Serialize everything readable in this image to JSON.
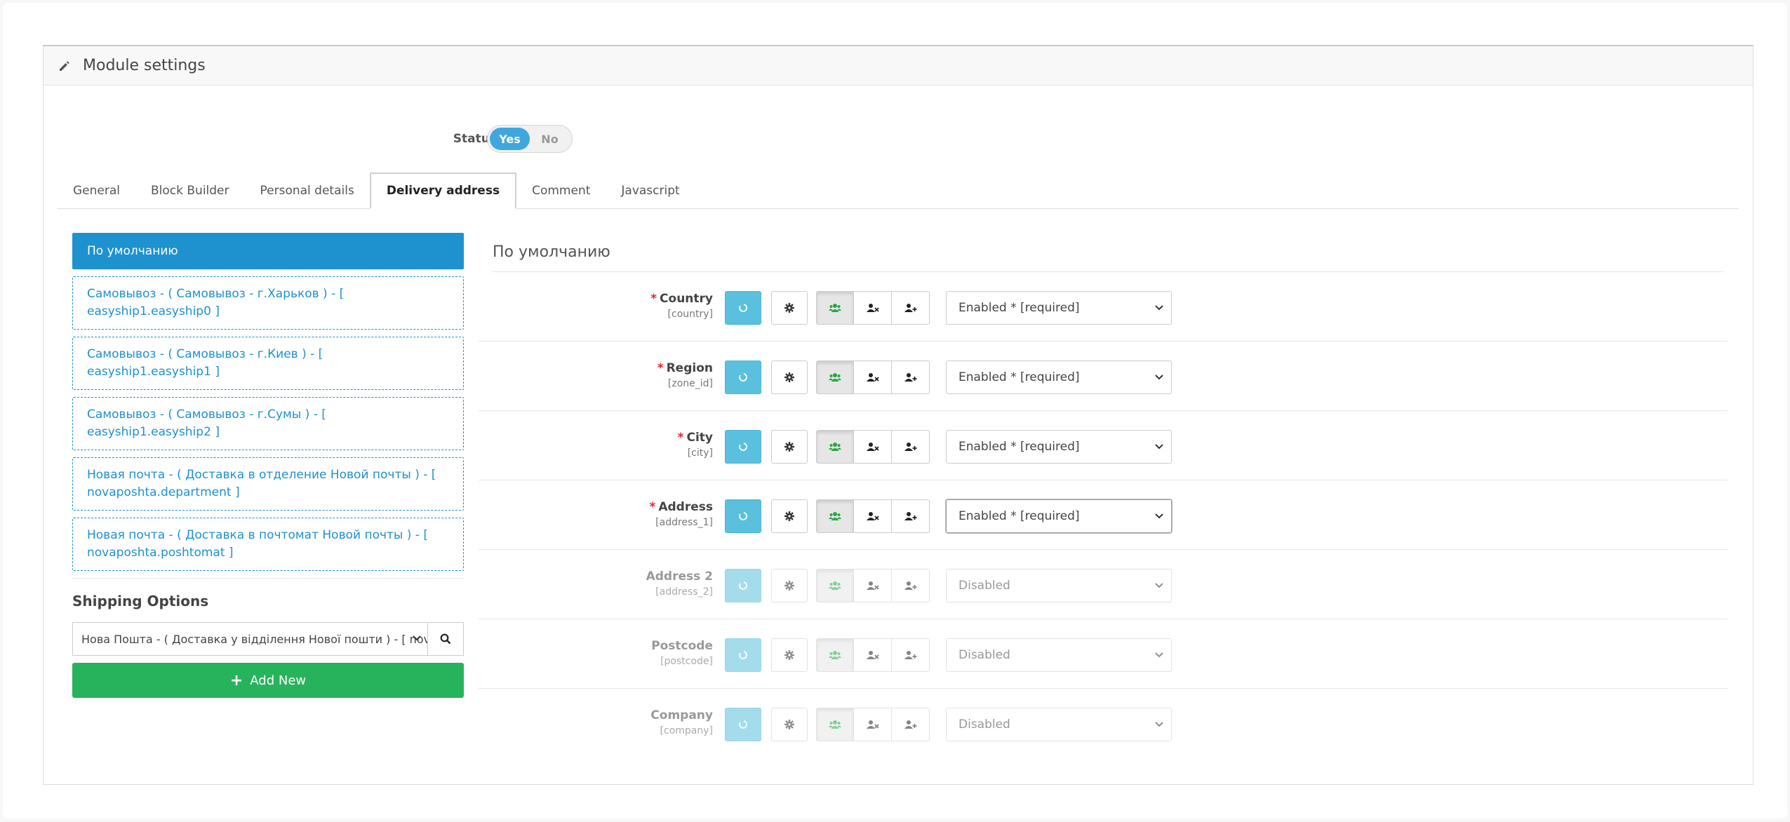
{
  "panel": {
    "title": "Module settings",
    "edit_icon": "pencil-icon"
  },
  "status": {
    "label": "Status",
    "yes": "Yes",
    "no": "No",
    "value": "Yes"
  },
  "tabs": [
    "General",
    "Block Builder",
    "Personal details",
    "Delivery address",
    "Comment",
    "Javascript"
  ],
  "active_tab": "Delivery address",
  "left": {
    "items": [
      "По умолчанию",
      "Самовывоз - ( Самовывоз - г.Харьков ) - [ easyship1.easyship0 ]",
      "Самовывоз - ( Самовывоз - г.Киев ) - [ easyship1.easyship1 ]",
      "Самовывоз - ( Самовывоз - г.Сумы ) - [ easyship1.easyship2 ]",
      "Новая почта - ( Доставка в отделение Новой почты ) - [ novaposhta.department ]",
      "Новая почта - ( Доставка в почтомат Новой почты ) - [ novaposhta.poshtomat ]"
    ],
    "shipping_title": "Shipping Options",
    "shipping_value": "Нова Пошта - ( Доставка у відділення Нової пошти ) - [ novaposhta.department ]",
    "add_new": "Add New"
  },
  "right": {
    "title": "По умолчанию",
    "fields": [
      {
        "name": "Country",
        "key": "[country]",
        "required": true,
        "value": "Enabled * [required]"
      },
      {
        "name": "Region",
        "key": "[zone_id]",
        "required": true,
        "value": "Enabled * [required]"
      },
      {
        "name": "City",
        "key": "[city]",
        "required": true,
        "value": "Enabled * [required]"
      },
      {
        "name": "Address",
        "key": "[address_1]",
        "required": true,
        "value": "Enabled * [required]"
      },
      {
        "name": "Address 2",
        "key": "[address_2]",
        "required": false,
        "value": "Disabled"
      },
      {
        "name": "Postcode",
        "key": "[postcode]",
        "required": false,
        "value": "Disabled"
      },
      {
        "name": "Company",
        "key": "[company]",
        "required": false,
        "value": "Disabled"
      }
    ]
  },
  "colors": {
    "primary": "#1e91cf",
    "info": "#5bc0de",
    "success": "#27b35c",
    "required": "#e3262a",
    "group_icon": "#27a744"
  }
}
